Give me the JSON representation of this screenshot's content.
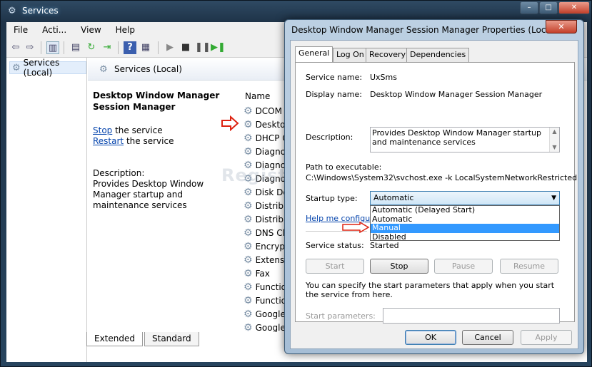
{
  "window": {
    "title": "Services",
    "controls": [
      "–",
      "□",
      "✕"
    ]
  },
  "menu": [
    "File",
    "Acti...",
    "View",
    "Help"
  ],
  "tree": {
    "root": "Services (Local)"
  },
  "pane_header": "Services (Local)",
  "detail": {
    "title": "Desktop Window Manager Session Manager",
    "stop_link": "Stop",
    "stop_suffix": " the service",
    "restart_link": "Restart",
    "restart_suffix": " the service",
    "desc_label": "Description:",
    "desc_text": "Provides Desktop Window Manager startup and maintenance services"
  },
  "list": {
    "header": "Name",
    "rows": [
      "DCOM",
      "Desktop",
      "DHCP C",
      "Diagnos",
      "Diagnos",
      "Diagnos",
      "Disk De",
      "Distribu",
      "Distribu",
      "DNS Cli",
      "Encrypt",
      "Extensib",
      "Fax",
      "Functio",
      "Functio",
      "Google",
      "Google"
    ]
  },
  "bottom_tabs": [
    "Extended",
    "Standard"
  ],
  "watermark": "Registry Recycler",
  "dialog": {
    "title": "Desktop Window Manager Session Manager Properties (Local Co...",
    "close": "✕",
    "tabs": [
      "General",
      "Log On",
      "Recovery",
      "Dependencies"
    ],
    "service_name_label": "Service name:",
    "service_name": "UxSms",
    "display_name_label": "Display name:",
    "display_name": "Desktop Window Manager Session Manager",
    "description_label": "Description:",
    "description": "Provides Desktop Window Manager startup and maintenance services",
    "path_label": "Path to executable:",
    "path": "C:\\Windows\\System32\\svchost.exe -k LocalSystemNetworkRestricted",
    "startup_label": "Startup type:",
    "startup_value": "Automatic",
    "startup_options": [
      "Automatic (Delayed Start)",
      "Automatic",
      "Manual",
      "Disabled"
    ],
    "startup_selected_index": 2,
    "help_link": "Help me configure s",
    "status_label": "Service status:",
    "status_value": "Started",
    "buttons": {
      "start": "Start",
      "stop": "Stop",
      "pause": "Pause",
      "resume": "Resume"
    },
    "params_text": "You can specify the start parameters that apply when you start the service from here.",
    "params_label": "Start parameters:",
    "footer": {
      "ok": "OK",
      "cancel": "Cancel",
      "apply": "Apply"
    }
  }
}
